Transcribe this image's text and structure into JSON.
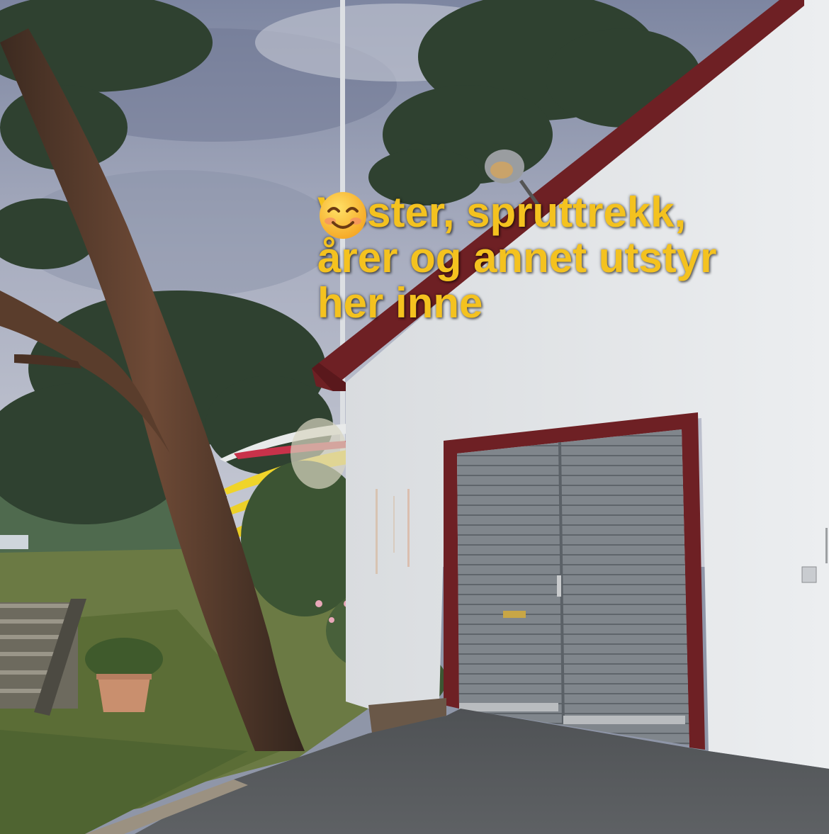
{
  "photo": {
    "subject": "kayak-storage-boathouse"
  },
  "caption": {
    "line1": "Vester, spruttrekk,",
    "line2": "årer og annet utstyr",
    "line3": "her inne",
    "emoji": "smiling-face-icon"
  },
  "colors": {
    "caption_text": "#f4c21f",
    "wall": "#e6e8ea",
    "door": "#7d838a",
    "door_frame": "#6e2024",
    "kayaks": "#f0d42a",
    "sky": "#9aa1b4"
  }
}
